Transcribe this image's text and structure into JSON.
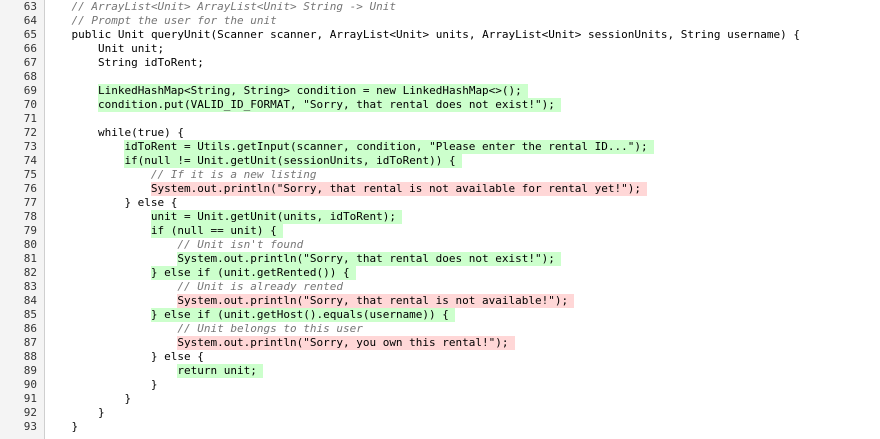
{
  "viewer": {
    "name": "code-diff-view",
    "colors": {
      "added_bg": "#ccffcc",
      "removed_bg": "#ffd7d7",
      "gutter_bg": "#f4f4f4",
      "comment": "#767676"
    }
  },
  "lines": [
    {
      "num": "63",
      "indent": 4,
      "text": "// ArrayList<Unit> ArrayList<Unit> String -> Unit",
      "kind": "comment",
      "hl": "none"
    },
    {
      "num": "64",
      "indent": 4,
      "text": "// Prompt the user for the unit",
      "kind": "comment",
      "hl": "none"
    },
    {
      "num": "65",
      "indent": 4,
      "text": "public Unit queryUnit(Scanner scanner, ArrayList<Unit> units, ArrayList<Unit> sessionUnits, String username) {",
      "kind": "code",
      "hl": "none"
    },
    {
      "num": "66",
      "indent": 8,
      "text": "Unit unit;",
      "kind": "code",
      "hl": "none"
    },
    {
      "num": "67",
      "indent": 8,
      "text": "String idToRent;",
      "kind": "code",
      "hl": "none"
    },
    {
      "num": "68",
      "indent": 0,
      "text": "",
      "kind": "code",
      "hl": "none"
    },
    {
      "num": "69",
      "indent": 8,
      "text": "LinkedHashMap<String, String> condition = new LinkedHashMap<>();",
      "kind": "code",
      "hl": "added"
    },
    {
      "num": "70",
      "indent": 8,
      "text": "condition.put(VALID_ID_FORMAT, \"Sorry, that rental does not exist!\");",
      "kind": "code",
      "hl": "added"
    },
    {
      "num": "71",
      "indent": 0,
      "text": "",
      "kind": "code",
      "hl": "none"
    },
    {
      "num": "72",
      "indent": 8,
      "text": "while(true) {",
      "kind": "code",
      "hl": "none"
    },
    {
      "num": "73",
      "indent": 12,
      "text": "idToRent = Utils.getInput(scanner, condition, \"Please enter the rental ID...\");",
      "kind": "code",
      "hl": "added"
    },
    {
      "num": "74",
      "indent": 12,
      "text": "if(null != Unit.getUnit(sessionUnits, idToRent)) {",
      "kind": "code",
      "hl": "added"
    },
    {
      "num": "75",
      "indent": 16,
      "text": "// If it is a new listing",
      "kind": "comment",
      "hl": "none"
    },
    {
      "num": "76",
      "indent": 16,
      "text": "System.out.println(\"Sorry, that rental is not available for rental yet!\");",
      "kind": "code",
      "hl": "removed"
    },
    {
      "num": "77",
      "indent": 12,
      "text": "} else {",
      "kind": "code",
      "hl": "none"
    },
    {
      "num": "78",
      "indent": 16,
      "text": "unit = Unit.getUnit(units, idToRent);",
      "kind": "code",
      "hl": "added"
    },
    {
      "num": "79",
      "indent": 16,
      "text": "if (null == unit) {",
      "kind": "code",
      "hl": "added"
    },
    {
      "num": "80",
      "indent": 20,
      "text": "// Unit isn't found",
      "kind": "comment",
      "hl": "none"
    },
    {
      "num": "81",
      "indent": 20,
      "text": "System.out.println(\"Sorry, that rental does not exist!\");",
      "kind": "code",
      "hl": "added"
    },
    {
      "num": "82",
      "indent": 16,
      "text": "} else if (unit.getRented()) {",
      "kind": "code",
      "hl": "added"
    },
    {
      "num": "83",
      "indent": 20,
      "text": "// Unit is already rented",
      "kind": "comment",
      "hl": "none"
    },
    {
      "num": "84",
      "indent": 20,
      "text": "System.out.println(\"Sorry, that rental is not available!\");",
      "kind": "code",
      "hl": "removed"
    },
    {
      "num": "85",
      "indent": 16,
      "text": "} else if (unit.getHost().equals(username)) {",
      "kind": "code",
      "hl": "added"
    },
    {
      "num": "86",
      "indent": 20,
      "text": "// Unit belongs to this user",
      "kind": "comment",
      "hl": "none"
    },
    {
      "num": "87",
      "indent": 20,
      "text": "System.out.println(\"Sorry, you own this rental!\");",
      "kind": "code",
      "hl": "removed"
    },
    {
      "num": "88",
      "indent": 16,
      "text": "} else {",
      "kind": "code",
      "hl": "none"
    },
    {
      "num": "89",
      "indent": 20,
      "text": "return unit;",
      "kind": "code",
      "hl": "added"
    },
    {
      "num": "90",
      "indent": 16,
      "text": "}",
      "kind": "code",
      "hl": "none"
    },
    {
      "num": "91",
      "indent": 12,
      "text": "}",
      "kind": "code",
      "hl": "none"
    },
    {
      "num": "92",
      "indent": 8,
      "text": "}",
      "kind": "code",
      "hl": "none"
    },
    {
      "num": "93",
      "indent": 4,
      "text": "}",
      "kind": "code",
      "hl": "none"
    }
  ]
}
